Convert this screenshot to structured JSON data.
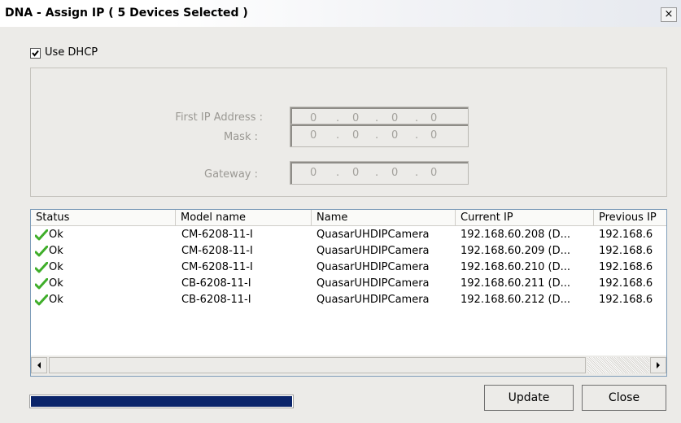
{
  "window": {
    "title": "DNA - Assign IP ( 5 Devices Selected )",
    "close_glyph": "×"
  },
  "dhcp": {
    "label": "Use DHCP",
    "checked": true
  },
  "fields": [
    {
      "label": "First IP Address :",
      "octets": [
        "0",
        "0",
        "0",
        "0"
      ]
    },
    {
      "label": "Mask :",
      "octets": [
        "0",
        "0",
        "0",
        "0"
      ]
    },
    {
      "label": "Gateway :",
      "octets": [
        "0",
        "0",
        "0",
        "0"
      ]
    }
  ],
  "ip_separator": ".",
  "table": {
    "columns": [
      "Status",
      "Model name",
      "Name",
      "Current IP",
      "Previous IP"
    ],
    "rows": [
      {
        "status": "Ok",
        "model": "CM-6208-11-I",
        "name": "QuasarUHDIPCamera",
        "current_ip": "192.168.60.208 (D...",
        "previous_ip": "192.168.6"
      },
      {
        "status": "Ok",
        "model": "CM-6208-11-I",
        "name": "QuasarUHDIPCamera",
        "current_ip": "192.168.60.209 (D...",
        "previous_ip": "192.168.6"
      },
      {
        "status": "Ok",
        "model": "CM-6208-11-I",
        "name": "QuasarUHDIPCamera",
        "current_ip": "192.168.60.210 (D...",
        "previous_ip": "192.168.6"
      },
      {
        "status": "Ok",
        "model": "CB-6208-11-I",
        "name": "QuasarUHDIPCamera",
        "current_ip": "192.168.60.211 (D...",
        "previous_ip": "192.168.6"
      },
      {
        "status": "Ok",
        "model": "CB-6208-11-I",
        "name": "QuasarUHDIPCamera",
        "current_ip": "192.168.60.212 (D...",
        "previous_ip": "192.168.6"
      }
    ]
  },
  "progress": {
    "fraction": 1.0,
    "color": "#0a246a"
  },
  "buttons": {
    "update": "Update",
    "close": "Close"
  },
  "icons": {
    "status_ok": "green-check-icon",
    "scroll_left": "arrow-left-icon",
    "scroll_right": "arrow-right-icon"
  }
}
